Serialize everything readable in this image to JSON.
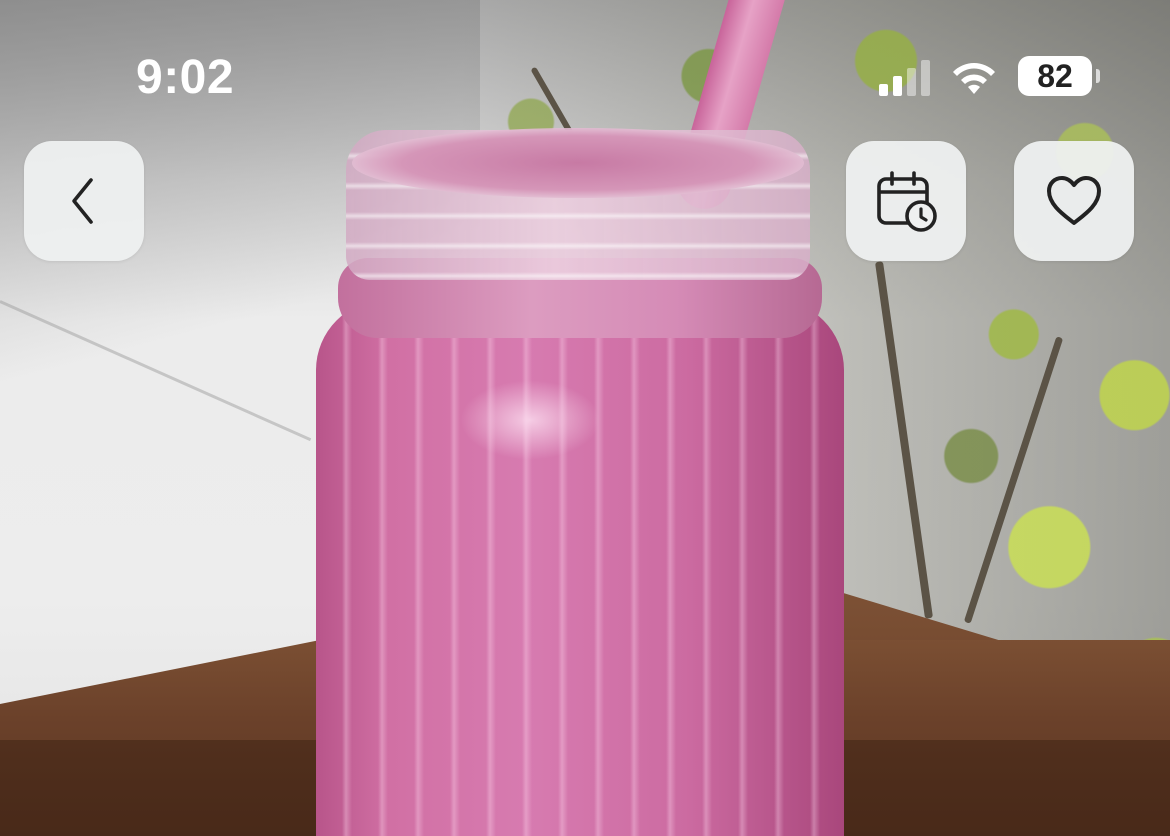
{
  "status_bar": {
    "time": "9:02",
    "battery_level": "82",
    "icons": [
      "cellular-signal-icon",
      "wifi-icon",
      "battery-icon"
    ]
  },
  "header": {
    "back_button": {
      "icon": "chevron-left-icon"
    },
    "schedule_button": {
      "icon": "calendar-clock-icon"
    },
    "favorite_button": {
      "icon": "heart-outline-icon"
    }
  },
  "colors": {
    "button_bg": "#EEF0F0",
    "icon_color": "#222222",
    "status_text": "#FFFFFF"
  }
}
